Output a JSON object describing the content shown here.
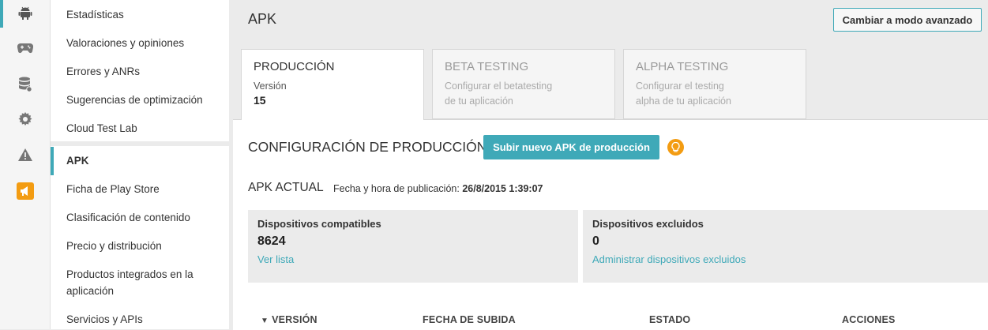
{
  "rail": {
    "icons": [
      "android-icon",
      "gamepad-icon",
      "database-icon",
      "gear-icon",
      "warning-icon",
      "megaphone-icon"
    ]
  },
  "nav": {
    "items": [
      {
        "label": "Estadísticas"
      },
      {
        "label": "Valoraciones y opiniones"
      },
      {
        "label": "Errores y ANRs"
      },
      {
        "label": "Sugerencias de optimización"
      },
      {
        "label": "Cloud Test Lab"
      },
      {
        "label": "APK"
      },
      {
        "label": "Ficha de Play Store"
      },
      {
        "label": "Clasificación de contenido"
      },
      {
        "label": "Precio y distribución"
      },
      {
        "label": "Productos integrados en la"
      },
      {
        "label": "aplicación"
      },
      {
        "label": "Servicios y APIs"
      }
    ]
  },
  "header": {
    "title": "APK",
    "advanced_button": "Cambiar a modo avanzado"
  },
  "tabs": [
    {
      "title": "PRODUCCIÓN",
      "line1": "Versión",
      "line2": "15"
    },
    {
      "title": "BETA TESTING",
      "line1": "Configurar el betatesting",
      "line2": "de tu aplicación"
    },
    {
      "title": "ALPHA TESTING",
      "line1": "Configurar el testing",
      "line2": "alpha de tu aplicación"
    }
  ],
  "config": {
    "title": "CONFIGURACIÓN DE PRODUCCIÓN",
    "upload_button": "Subir nuevo APK de producción"
  },
  "current_apk": {
    "label": "APK ACTUAL",
    "pub_label": "Fecha y hora de publicación:",
    "pub_date": "26/8/2015 1:39:07"
  },
  "cards": [
    {
      "title": "Dispositivos compatibles",
      "value": "8624",
      "link": "Ver lista"
    },
    {
      "title": "Dispositivos excluidos",
      "value": "0",
      "link": "Administrar dispositivos excluidos"
    }
  ],
  "table": {
    "sort_indicator": "▼",
    "columns": [
      "VERSIÓN",
      "FECHA DE SUBIDA",
      "ESTADO",
      "ACCIONES"
    ]
  },
  "colors": {
    "accent": "#3fa9b8",
    "bulb": "#f39c12",
    "megaphone_bg": "#f39c12"
  }
}
